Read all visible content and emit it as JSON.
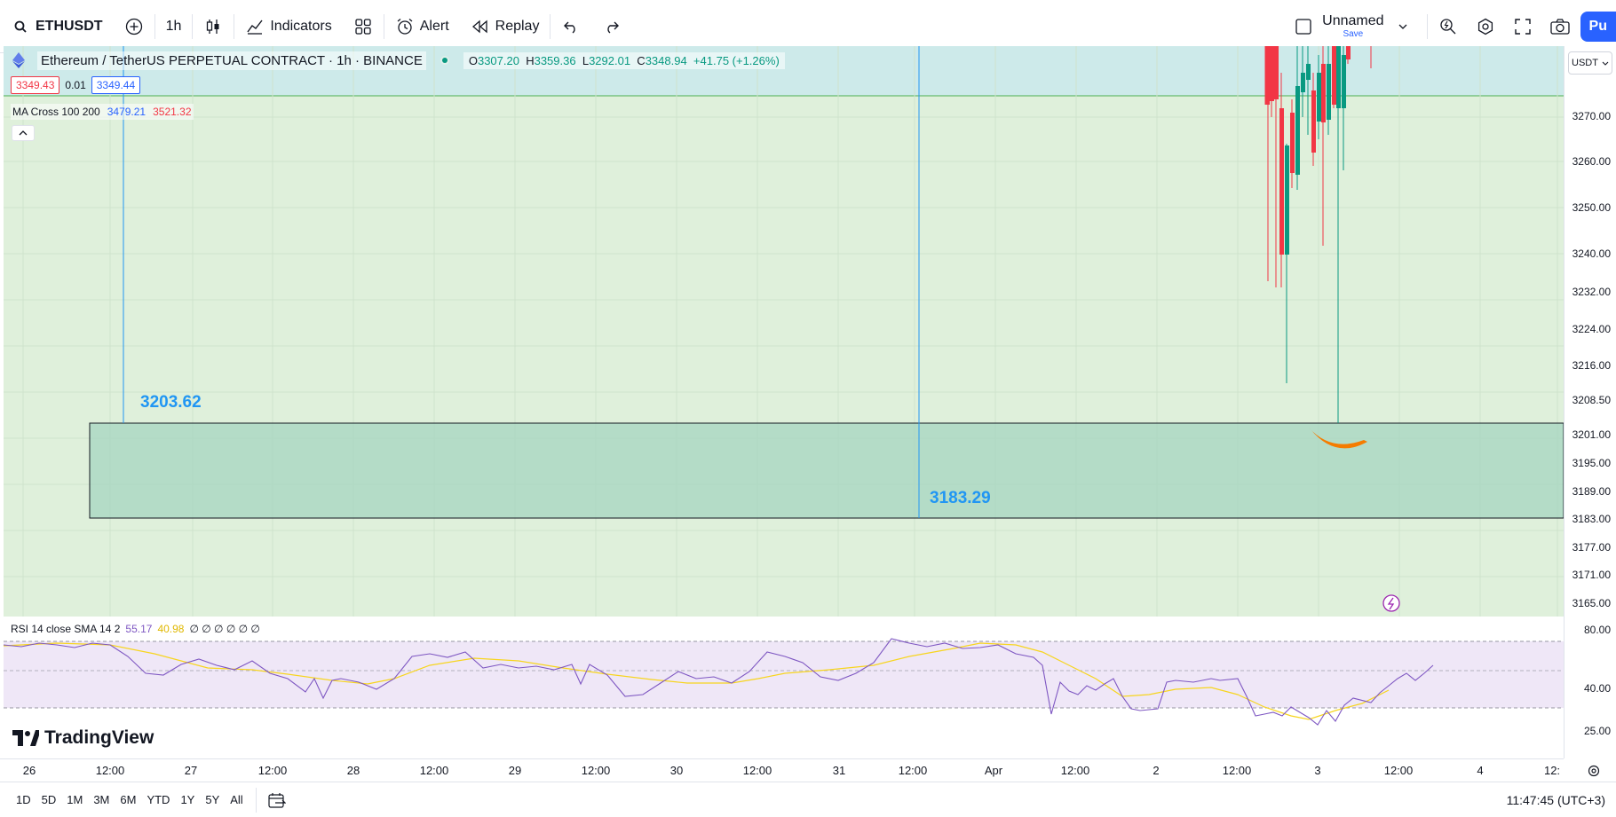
{
  "toolbar": {
    "symbol": "ETHUSDT",
    "interval": "1h",
    "indicators_label": "Indicators",
    "alert_label": "Alert",
    "replay_label": "Replay",
    "layout_name": "Unnamed",
    "save_label": "Save",
    "publish_label": "Pu"
  },
  "legend": {
    "title": "Ethereum / TetherUS PERPETUAL CONTRACT · 1h · BINANCE",
    "open": "3307.20",
    "high": "3359.36",
    "low": "3292.01",
    "close": "3348.94",
    "change": "+41.75 (+1.26%)",
    "sell_price": "3349.43",
    "spread": "0.01",
    "buy_price": "3349.44"
  },
  "ma_legend": {
    "label": "MA Cross 100 200",
    "fast": "3479.21",
    "slow": "3521.32"
  },
  "annotations": {
    "upper_zone_label": "3203.62",
    "lower_zone_label": "3183.29"
  },
  "price_scale": {
    "currency": "USDT",
    "ticks": [
      "3270.00",
      "3260.00",
      "3250.00",
      "3240.00",
      "3232.00",
      "3224.00",
      "3216.00",
      "3208.50",
      "3201.00",
      "3195.00",
      "3189.00",
      "3183.00",
      "3177.00",
      "3171.00",
      "3165.00"
    ],
    "rsi_ticks": [
      "80.00",
      "40.00",
      "25.00"
    ]
  },
  "rsi": {
    "label": "RSI 14 close SMA 14 2",
    "value": "55.17",
    "sma": "40.98",
    "extras": "∅ ∅ ∅ ∅ ∅ ∅"
  },
  "time_axis": [
    "26",
    "12:00",
    "27",
    "12:00",
    "28",
    "12:00",
    "29",
    "12:00",
    "30",
    "12:00",
    "31",
    "12:00",
    "Apr",
    "12:00",
    "2",
    "12:00",
    "3",
    "12:00",
    "4",
    "12:"
  ],
  "bottom_bar": {
    "ranges": [
      "1D",
      "5D",
      "1M",
      "3M",
      "6M",
      "YTD",
      "1Y",
      "5Y",
      "All"
    ],
    "clock": "11:47:45 (UTC+3)"
  },
  "branding": {
    "logo_text": "TradingView"
  },
  "colors": {
    "up": "#089981",
    "down": "#f23645",
    "rsi_line": "#7e57c2",
    "rsi_sma": "#f7d51e",
    "zone": "#2196f3"
  }
}
